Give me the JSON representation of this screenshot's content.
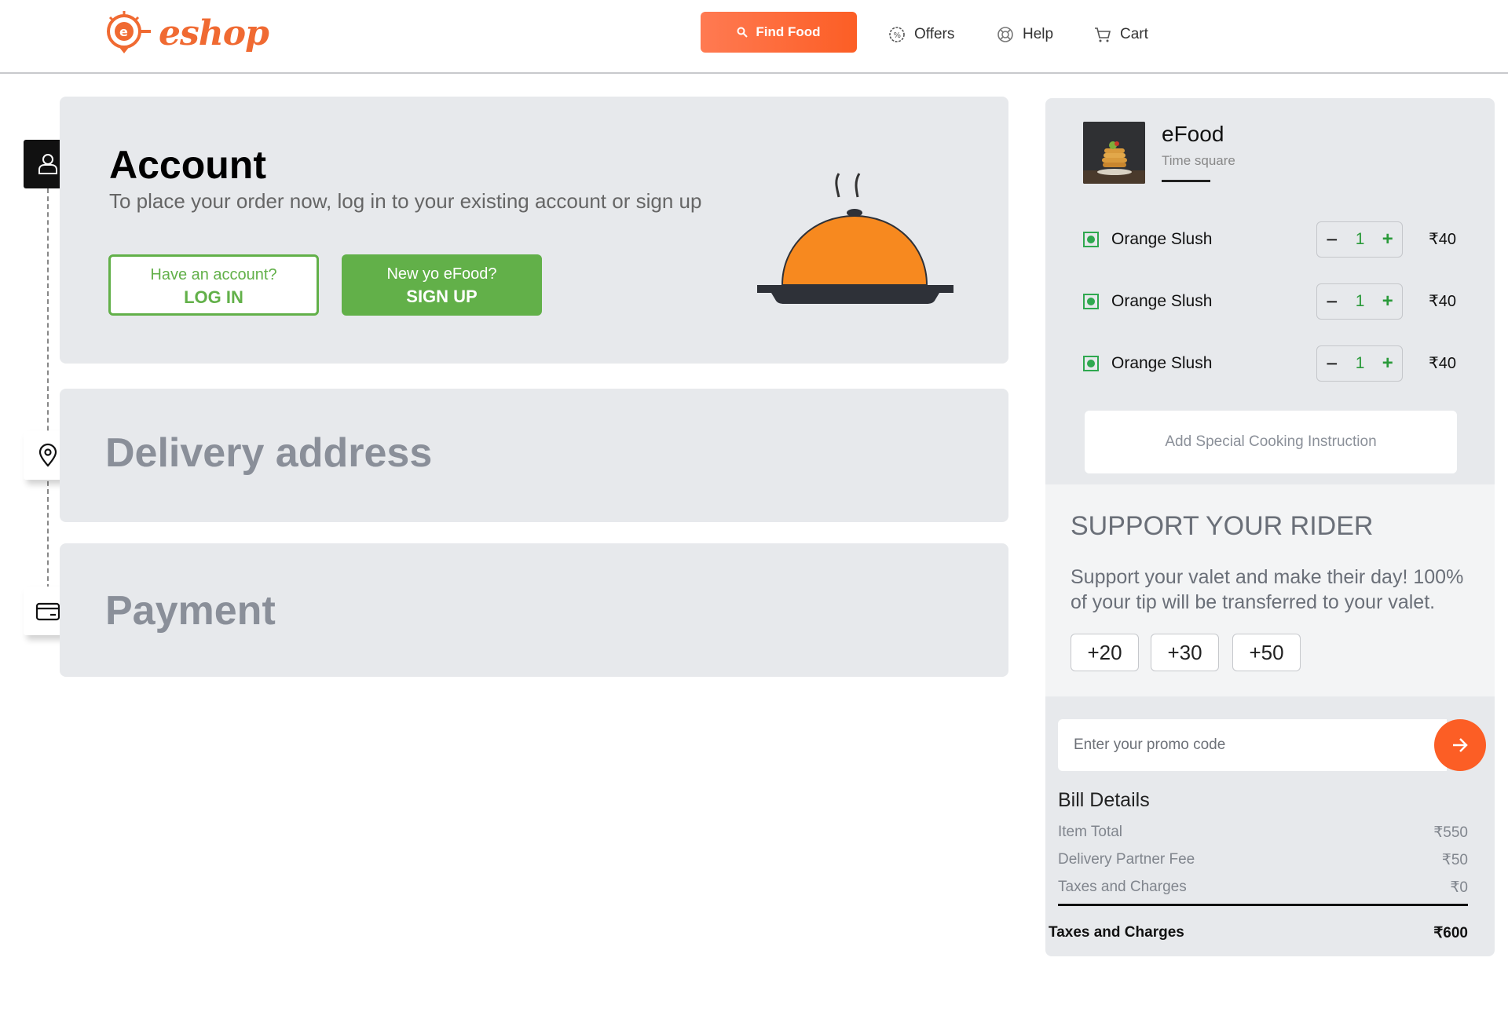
{
  "header": {
    "logo_text": "eshop",
    "find_food_label": "Find Food",
    "nav": [
      {
        "label": "Offers",
        "icon": "offers-icon"
      },
      {
        "label": "Help",
        "icon": "help-icon"
      },
      {
        "label": "Cart",
        "icon": "cart-icon"
      }
    ]
  },
  "colors": {
    "accent": "#fc5e25",
    "green": "#62b049",
    "card_bg": "#e7e9ec"
  },
  "account": {
    "title": "Account",
    "subtitle": "To place your order now, log in to your existing account or sign up",
    "login_small": "Have an account?",
    "login_big": "LOG IN",
    "signup_small": "New yo eFood?",
    "signup_big": "SIGN UP"
  },
  "delivery": {
    "title": "Delivery address"
  },
  "payment": {
    "title": "Payment"
  },
  "restaurant": {
    "name": "eFood",
    "location": "Time square"
  },
  "cart_items": [
    {
      "name": "Orange Slush",
      "qty": "1",
      "price": "₹40"
    },
    {
      "name": "Orange Slush",
      "qty": "1",
      "price": "₹40"
    },
    {
      "name": "Orange Slush",
      "qty": "1",
      "price": "₹40"
    }
  ],
  "special_instruction_label": "Add Special Cooking Instruction",
  "rider": {
    "title": "SUPPORT YOUR RIDER",
    "text": "Support your valet and make their day! 100% of your tip will be transferred to your valet.",
    "tips": [
      "+20",
      "+30",
      "+50"
    ]
  },
  "promo": {
    "placeholder": "Enter your promo code"
  },
  "bill": {
    "title": "Bill Details",
    "rows": [
      {
        "label": "Item Total",
        "value": "₹550"
      },
      {
        "label": "Delivery Partner Fee",
        "value": "₹50"
      },
      {
        "label": "Taxes and Charges",
        "value": "₹0"
      }
    ],
    "total_label": "Taxes and Charges",
    "total_value": "₹600"
  }
}
